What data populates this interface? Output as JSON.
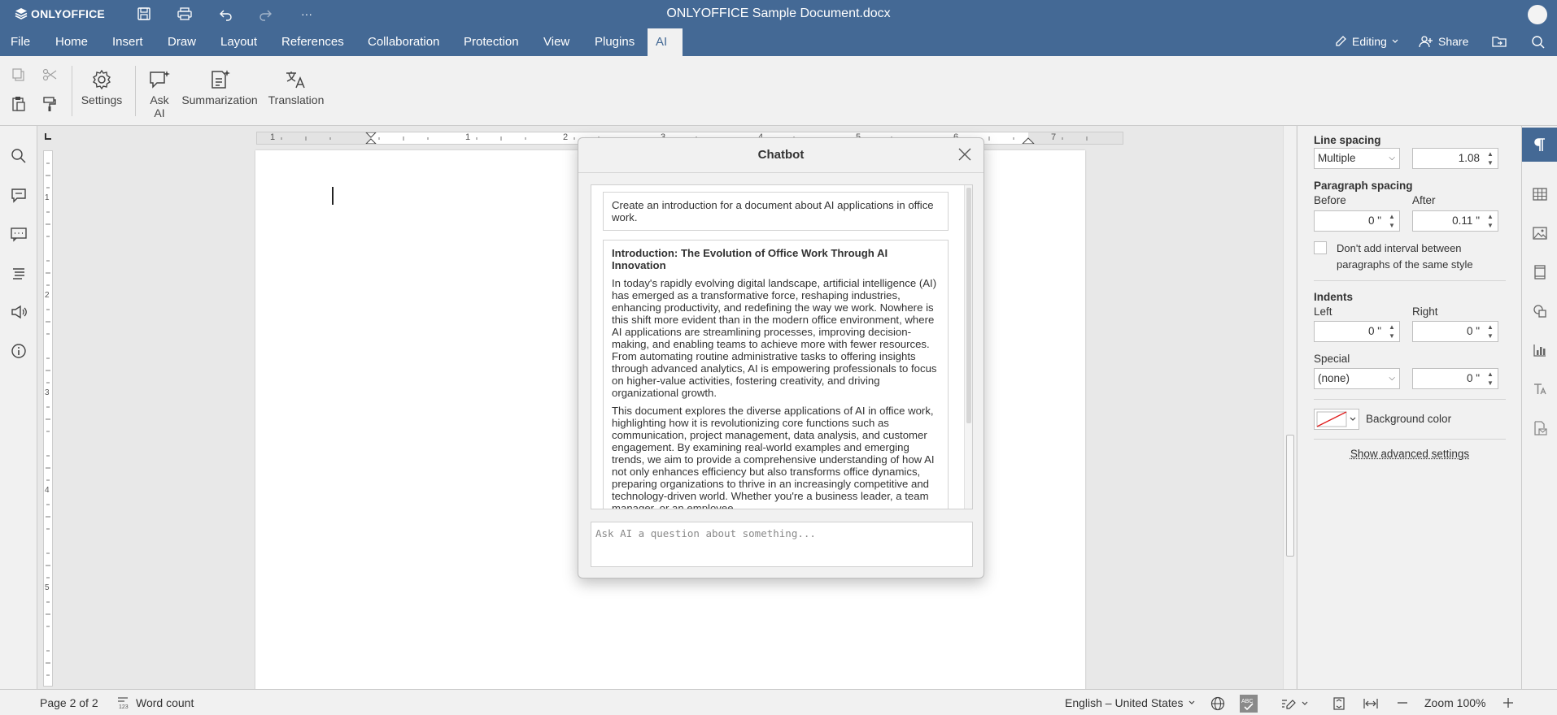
{
  "app": {
    "logo_text": "ONLYOFFICE",
    "document_title": "ONLYOFFICE Sample Document.docx",
    "more_label": "···"
  },
  "menu": {
    "tabs": [
      {
        "label": "File"
      },
      {
        "label": "Home"
      },
      {
        "label": "Insert"
      },
      {
        "label": "Draw"
      },
      {
        "label": "Layout"
      },
      {
        "label": "References"
      },
      {
        "label": "Collaboration"
      },
      {
        "label": "Protection"
      },
      {
        "label": "View"
      },
      {
        "label": "Plugins"
      },
      {
        "label": "AI"
      }
    ],
    "active_tab": "AI",
    "editing_label": "Editing",
    "share_label": "Share"
  },
  "toolbar": {
    "settings_label": "Settings",
    "ask_ai_label_1": "Ask",
    "ask_ai_label_2": "AI",
    "summarization_label": "Summarization",
    "translation_label": "Translation"
  },
  "ruler": {
    "h_numbers": [
      "1",
      "1",
      "2",
      "3",
      "4",
      "5",
      "6",
      "7"
    ],
    "v_numbers": [
      "1",
      "2",
      "3",
      "4",
      "5"
    ]
  },
  "chatbot": {
    "title": "Chatbot",
    "user_message": "Create an introduction for a document about AI applications in office work.",
    "ai_heading": "Introduction: The Evolution of Office Work Through AI Innovation",
    "ai_paragraph_1": "In today's rapidly evolving digital landscape, artificial intelligence (AI) has emerged as a transformative force, reshaping industries, enhancing productivity, and redefining the way we work. Nowhere is this shift more evident than in the modern office environment, where AI applications are streamlining processes, improving decision-making, and enabling teams to achieve more with fewer resources. From automating routine administrative tasks to offering insights through advanced analytics, AI is empowering professionals to focus on higher-value activities, fostering creativity, and driving organizational growth.",
    "ai_paragraph_2": "This document explores the diverse applications of AI in office work, highlighting how it is revolutionizing core functions such as communication, project management, data analysis, and customer engagement. By examining real-world examples and emerging trends, we aim to provide a comprehensive understanding of how AI not only enhances efficiency but also transforms office dynamics, preparing organizations to thrive in an increasingly competitive and technology-driven world. Whether you're a business leader, a team manager, or an employee",
    "input_placeholder": "Ask AI a question about something..."
  },
  "paragraph_settings": {
    "line_spacing_label": "Line spacing",
    "line_spacing_type": "Multiple",
    "line_spacing_value": "1.08",
    "paragraph_spacing_label": "Paragraph spacing",
    "before_label": "Before",
    "after_label": "After",
    "before_value": "0 \"",
    "after_value": "0.11 \"",
    "dont_add_interval_label": "Don't add interval between paragraphs of the same style",
    "dont_add_interval_checked": false,
    "indents_label": "Indents",
    "left_label": "Left",
    "right_label": "Right",
    "left_value": "0 \"",
    "right_value": "0 \"",
    "special_label": "Special",
    "special_type": "(none)",
    "special_value": "0 \"",
    "background_color_label": "Background color",
    "show_advanced_label": "Show advanced settings"
  },
  "statusbar": {
    "page_info": "Page 2 of 2",
    "word_count_label": "Word count",
    "language": "English – United States",
    "zoom_label": "Zoom 100%"
  },
  "colors": {
    "brand": "#446995",
    "toolbar_bg": "#f1f1f1",
    "workspace_bg": "#e8e8e8"
  }
}
